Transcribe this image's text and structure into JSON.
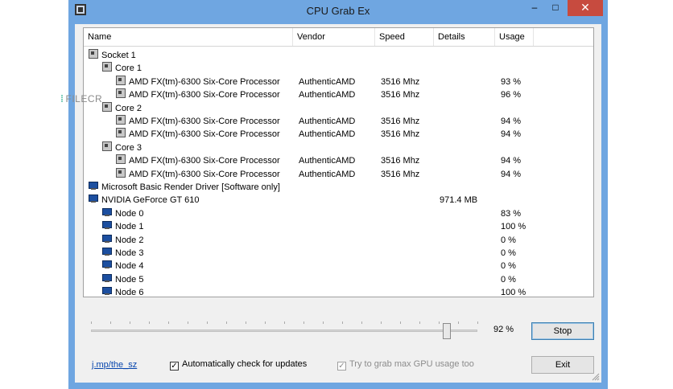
{
  "window": {
    "title": "CPU Grab Ex",
    "min_glyph": "–",
    "max_glyph": "□",
    "close_glyph": "✕"
  },
  "watermark": {
    "text": "FILECR"
  },
  "list": {
    "columns": [
      "Name",
      "Vendor",
      "Speed",
      "Details",
      "Usage"
    ],
    "rows": [
      {
        "level": 0,
        "icon": "cpu-socket-icon",
        "name": "Socket 1",
        "vendor": "",
        "speed": "",
        "details": "",
        "usage": ""
      },
      {
        "level": 1,
        "icon": "cpu-core-icon",
        "name": "Core 1",
        "vendor": "",
        "speed": "",
        "details": "",
        "usage": ""
      },
      {
        "level": 2,
        "icon": "cpu-thread-icon",
        "name": "AMD FX(tm)-6300 Six-Core Processor",
        "vendor": "AuthenticAMD",
        "speed": "3516 Mhz",
        "details": "",
        "usage": "93 %"
      },
      {
        "level": 2,
        "icon": "cpu-thread-icon",
        "name": "AMD FX(tm)-6300 Six-Core Processor",
        "vendor": "AuthenticAMD",
        "speed": "3516 Mhz",
        "details": "",
        "usage": "96 %"
      },
      {
        "level": 1,
        "icon": "cpu-core-icon",
        "name": "Core 2",
        "vendor": "",
        "speed": "",
        "details": "",
        "usage": ""
      },
      {
        "level": 2,
        "icon": "cpu-thread-icon",
        "name": "AMD FX(tm)-6300 Six-Core Processor",
        "vendor": "AuthenticAMD",
        "speed": "3516 Mhz",
        "details": "",
        "usage": "94 %"
      },
      {
        "level": 2,
        "icon": "cpu-thread-icon",
        "name": "AMD FX(tm)-6300 Six-Core Processor",
        "vendor": "AuthenticAMD",
        "speed": "3516 Mhz",
        "details": "",
        "usage": "94 %"
      },
      {
        "level": 1,
        "icon": "cpu-core-icon",
        "name": "Core 3",
        "vendor": "",
        "speed": "",
        "details": "",
        "usage": ""
      },
      {
        "level": 2,
        "icon": "cpu-thread-icon",
        "name": "AMD FX(tm)-6300 Six-Core Processor",
        "vendor": "AuthenticAMD",
        "speed": "3516 Mhz",
        "details": "",
        "usage": "94 %"
      },
      {
        "level": 2,
        "icon": "cpu-thread-icon",
        "name": "AMD FX(tm)-6300 Six-Core Processor",
        "vendor": "AuthenticAMD",
        "speed": "3516 Mhz",
        "details": "",
        "usage": "94 %"
      },
      {
        "level": 0,
        "icon": "gpu-icon",
        "name": "Microsoft Basic Render Driver [Software only]",
        "vendor": "",
        "speed": "",
        "details": "",
        "usage": ""
      },
      {
        "level": 0,
        "icon": "gpu-icon",
        "name": "NVIDIA GeForce GT 610",
        "vendor": "",
        "speed": "",
        "details": "971.4 MB",
        "usage": ""
      },
      {
        "level": 1,
        "icon": "gpu-node-icon",
        "name": "Node 0",
        "vendor": "",
        "speed": "",
        "details": "",
        "usage": "83 %"
      },
      {
        "level": 1,
        "icon": "gpu-node-icon",
        "name": "Node 1",
        "vendor": "",
        "speed": "",
        "details": "",
        "usage": "100 %"
      },
      {
        "level": 1,
        "icon": "gpu-node-icon",
        "name": "Node 2",
        "vendor": "",
        "speed": "",
        "details": "",
        "usage": "0 %"
      },
      {
        "level": 1,
        "icon": "gpu-node-icon",
        "name": "Node 3",
        "vendor": "",
        "speed": "",
        "details": "",
        "usage": "0 %"
      },
      {
        "level": 1,
        "icon": "gpu-node-icon",
        "name": "Node 4",
        "vendor": "",
        "speed": "",
        "details": "",
        "usage": "0 %"
      },
      {
        "level": 1,
        "icon": "gpu-node-icon",
        "name": "Node 5",
        "vendor": "",
        "speed": "",
        "details": "",
        "usage": "0 %"
      },
      {
        "level": 1,
        "icon": "gpu-node-icon",
        "name": "Node 6",
        "vendor": "",
        "speed": "",
        "details": "",
        "usage": "100 %"
      }
    ]
  },
  "slider": {
    "value_percent": 92,
    "label": "92 %"
  },
  "buttons": {
    "stop": "Stop",
    "exit": "Exit"
  },
  "footer": {
    "link": "j.mp/the_sz",
    "auto_update": {
      "label": "Automatically check for updates",
      "checked": true
    },
    "gpu_max": {
      "label": "Try to grab max GPU usage too",
      "checked": true,
      "disabled": true
    }
  }
}
